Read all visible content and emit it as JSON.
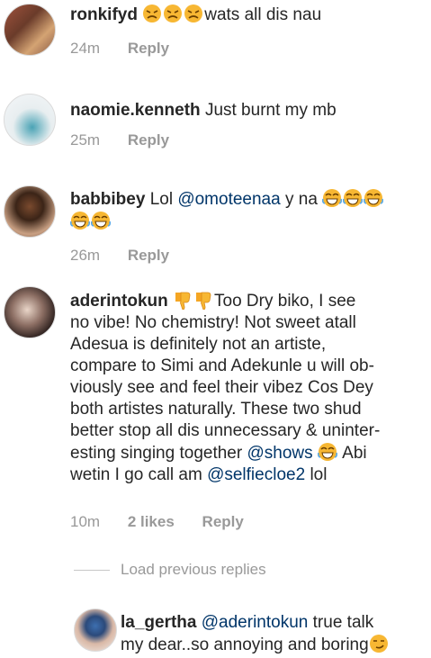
{
  "comments": [
    {
      "username": "ronkifyd",
      "text": "wats all dis nau",
      "time": "24m",
      "reply": "Reply"
    },
    {
      "username": "naomie.kenneth",
      "text": "Just burnt my mb",
      "time": "25m",
      "reply": "Reply"
    },
    {
      "username": "babbibey",
      "text_before": "Lol",
      "mention": "@omoteenaa",
      "text_after": "y na",
      "time": "26m",
      "reply": "Reply"
    },
    {
      "username": "aderintokun",
      "lines": [
        "Too Dry biko, I see",
        "no vibe! No chemistry! Not sweet atall",
        "Adesua is definitely not an artiste,",
        "compare to Simi and Adekunle u will ob-",
        "viously see and feel their  vibez Cos Dey",
        "both artistes naturally. These two shud",
        "better stop all dis unnecessary & uninter-",
        "esting singing together"
      ],
      "mention1": "@shows",
      "line9_a": "Abi",
      "line10_a": "wetin I go call am",
      "mention2": "@selfiecloe2",
      "line10_b": "lol",
      "time": "10m",
      "likes": "2 likes",
      "reply": "Reply"
    }
  ],
  "load_previous": "Load previous replies",
  "reply_comment": {
    "username": "la_gertha",
    "mention": "@aderintokun",
    "line1": "true talk",
    "line2": "my dear..so annoying and boring"
  },
  "colors": {
    "mention": "#003569",
    "meta": "#999999",
    "emoji": "#f7b733"
  },
  "icons": [
    "persevere-emoji",
    "laughing-emoji",
    "thumbs-down-emoji",
    "smirk-emoji"
  ]
}
